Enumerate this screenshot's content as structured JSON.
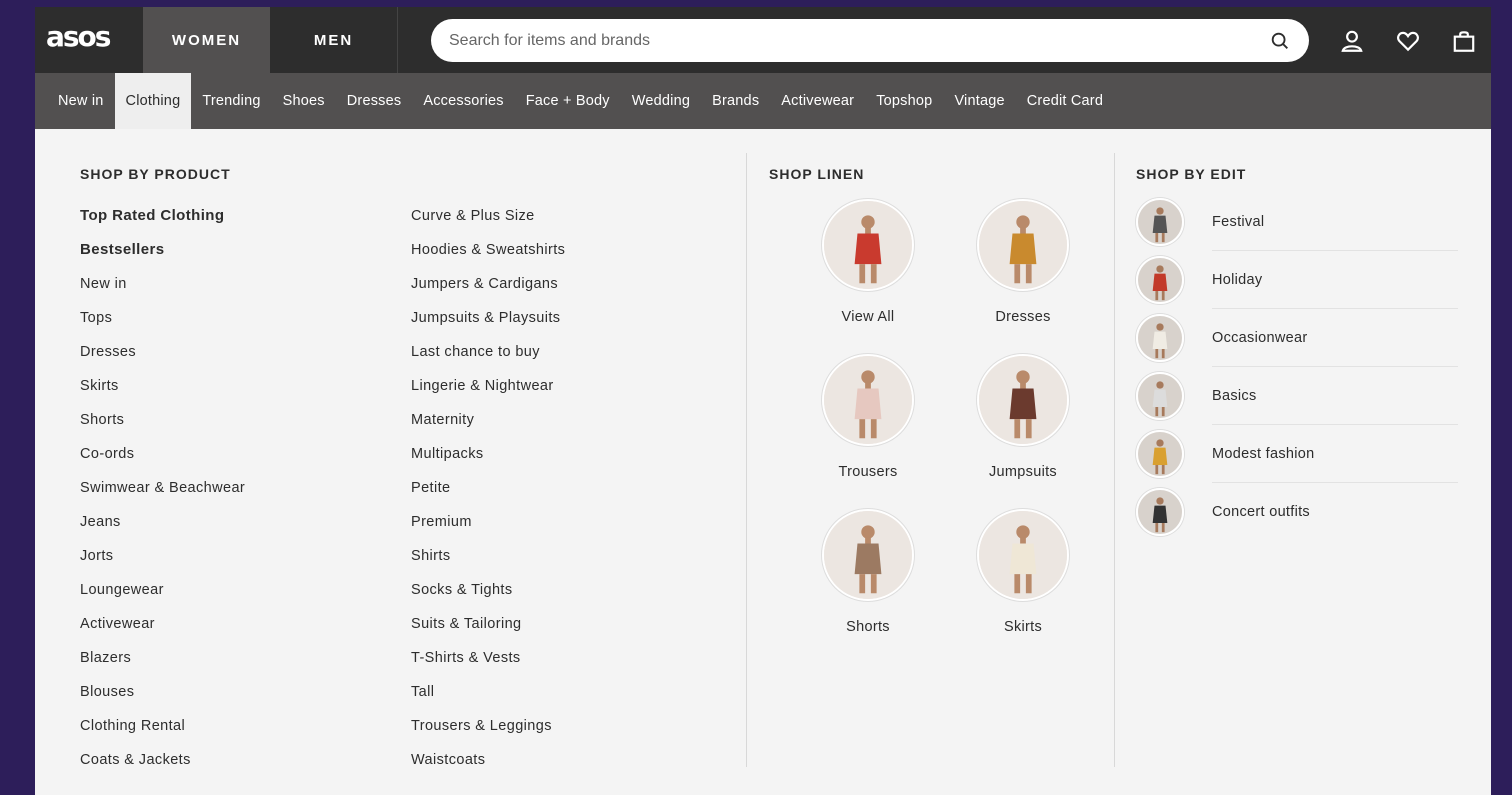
{
  "header": {
    "logo": "asos",
    "tabs": [
      {
        "label": "WOMEN",
        "active": true
      },
      {
        "label": "MEN",
        "active": false
      }
    ],
    "search": {
      "placeholder": "Search for items and brands",
      "value": ""
    },
    "icons": [
      "search-icon",
      "account-icon",
      "heart-icon",
      "bag-icon"
    ]
  },
  "nav": {
    "items": [
      {
        "label": "New in"
      },
      {
        "label": "Clothing",
        "active": true
      },
      {
        "label": "Trending"
      },
      {
        "label": "Shoes"
      },
      {
        "label": "Dresses"
      },
      {
        "label": "Accessories"
      },
      {
        "label": "Face + Body"
      },
      {
        "label": "Wedding"
      },
      {
        "label": "Brands"
      },
      {
        "label": "Activewear"
      },
      {
        "label": "Topshop"
      },
      {
        "label": "Vintage"
      },
      {
        "label": "Credit Card"
      }
    ]
  },
  "menu": {
    "shop_by_product": {
      "heading": "SHOP BY PRODUCT",
      "col1": [
        "Top Rated Clothing",
        "Bestsellers",
        "New in",
        "Tops",
        "Dresses",
        "Skirts",
        "Shorts",
        "Co-ords",
        "Swimwear & Beachwear",
        "Jeans",
        "Jorts",
        "Loungewear",
        "Activewear",
        "Blazers",
        "Blouses",
        "Clothing Rental",
        "Coats & Jackets"
      ],
      "col2": [
        "Curve & Plus Size",
        "Hoodies & Sweatshirts",
        "Jumpers & Cardigans",
        "Jumpsuits & Playsuits",
        "Last chance to buy",
        "Lingerie & Nightwear",
        "Maternity",
        "Multipacks",
        "Petite",
        "Premium",
        "Shirts",
        "Socks & Tights",
        "Suits & Tailoring",
        "T-Shirts & Vests",
        "Tall",
        "Trousers & Leggings",
        "Waistcoats"
      ]
    },
    "shop_linen": {
      "heading": "SHOP LINEN",
      "items": [
        {
          "label": "View All",
          "color": "#c93a2e"
        },
        {
          "label": "Dresses",
          "color": "#c98a2e"
        },
        {
          "label": "Trousers",
          "color": "#e6c8c0"
        },
        {
          "label": "Jumpsuits",
          "color": "#6b3a2e"
        },
        {
          "label": "Shorts",
          "color": "#9c7a62"
        },
        {
          "label": "Skirts",
          "color": "#efe7d6"
        }
      ]
    },
    "shop_by_edit": {
      "heading": "SHOP BY EDIT",
      "items": [
        {
          "label": "Festival",
          "color": "#555"
        },
        {
          "label": "Holiday",
          "color": "#c23a2a"
        },
        {
          "label": "Occasionwear",
          "color": "#f0ece4"
        },
        {
          "label": "Basics",
          "color": "#dcdcdc"
        },
        {
          "label": "Modest fashion",
          "color": "#d9a030"
        },
        {
          "label": "Concert outfits",
          "color": "#333"
        }
      ]
    }
  }
}
